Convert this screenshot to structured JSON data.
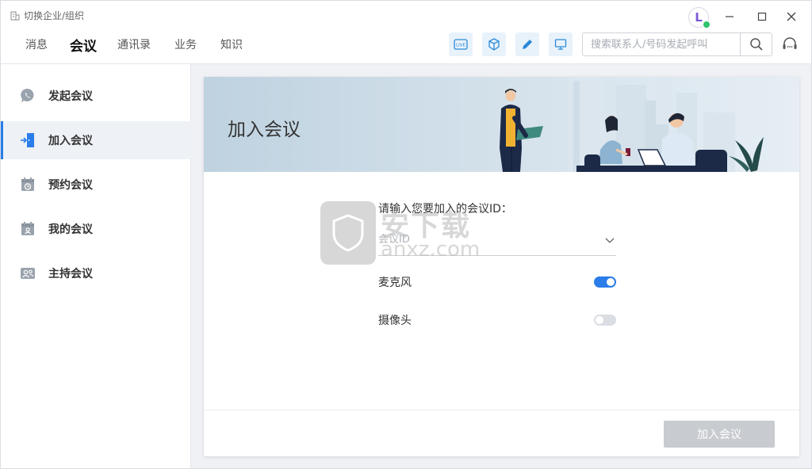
{
  "titlebar": {
    "org_switch_label": "切换企业/组织",
    "avatar_letter": "L"
  },
  "nav": {
    "tabs": [
      {
        "label": "消息",
        "active": false
      },
      {
        "label": "会议",
        "active": true
      },
      {
        "label": "通讯录",
        "active": false
      },
      {
        "label": "业务",
        "active": false
      },
      {
        "label": "知识",
        "active": false
      }
    ],
    "tools": [
      "live-icon",
      "cube-icon",
      "pencil-icon",
      "monitor-icon"
    ],
    "search_placeholder": "搜索联系人/号码发起呼叫"
  },
  "sidebar": {
    "items": [
      {
        "label": "发起会议",
        "icon": "phone-bubble-icon",
        "active": false
      },
      {
        "label": "加入会议",
        "icon": "enter-door-icon",
        "active": true
      },
      {
        "label": "预约会议",
        "icon": "calendar-clock-icon",
        "active": false
      },
      {
        "label": "我的会议",
        "icon": "calendar-person-icon",
        "active": false
      },
      {
        "label": "主持会议",
        "icon": "host-people-icon",
        "active": false
      }
    ]
  },
  "main": {
    "banner_title": "加入会议",
    "form": {
      "prompt_label": "请输入您要加入的会议ID：",
      "id_placeholder": "会议ID",
      "id_value": "",
      "microphone_label": "麦克风",
      "microphone_on": true,
      "camera_label": "摄像头",
      "camera_on": false
    },
    "join_button_label": "加入会议"
  },
  "watermark": {
    "text": "安下载",
    "url": "anxz.com"
  },
  "colors": {
    "accent": "#2b7de9",
    "button_disabled": "#c8cbd0",
    "active_bg": "#eef1f6"
  }
}
